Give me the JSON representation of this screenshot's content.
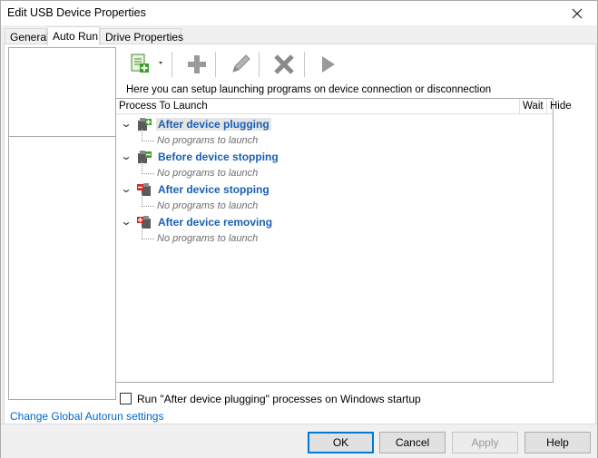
{
  "window": {
    "title": "Edit USB Device Properties"
  },
  "tabs": [
    {
      "label": "General",
      "active": false
    },
    {
      "label": "Auto Run",
      "active": true
    },
    {
      "label": "Drive Properties",
      "active": false
    }
  ],
  "toolbar": {
    "add_label": "Add program",
    "buttons": [
      "add-program",
      "add",
      "edit",
      "delete",
      "run"
    ]
  },
  "main": {
    "hint": "Here you can setup launching programs on device connection or disconnection",
    "columns": {
      "process": "Process To Launch",
      "wait": "Wait",
      "hide": "Hide"
    },
    "groups": [
      {
        "label": "After device plugging",
        "child": "No programs to launch",
        "icon": "plug-green-icon",
        "selected": true
      },
      {
        "label": "Before device stopping",
        "child": "No programs to launch",
        "icon": "plug-green-icon",
        "selected": false
      },
      {
        "label": "After device stopping",
        "child": "No programs to launch",
        "icon": "plug-red-icon",
        "selected": false
      },
      {
        "label": "After device removing",
        "child": "No programs to launch",
        "icon": "plug-red-icon",
        "selected": false
      }
    ]
  },
  "startup_option": {
    "label": "Run \"After device plugging\" processes on Windows startup",
    "checked": false
  },
  "global_link": "Change Global Autorun settings",
  "buttons": {
    "ok": "OK",
    "cancel": "Cancel",
    "apply": "Apply",
    "help": "Help"
  },
  "colors": {
    "accent": "#0078d7",
    "group_text": "#1a5fb4",
    "link": "#0066cc"
  }
}
